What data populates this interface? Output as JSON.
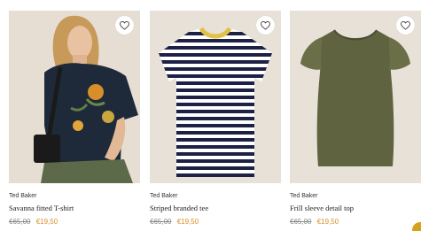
{
  "products": [
    {
      "brand": "Ted Baker",
      "title": "Savanna fitted T-shirt",
      "old_price": "€65,00",
      "new_price": "€19,50",
      "wishlist_icon": "heart-outline-icon"
    },
    {
      "brand": "Ted Baker",
      "title": "Striped branded tee",
      "old_price": "€65,00",
      "new_price": "€19,50",
      "wishlist_icon": "heart-outline-icon"
    },
    {
      "brand": "Ted Baker",
      "title": "Frill sleeve detail top",
      "old_price": "€65,00",
      "new_price": "€19,50",
      "wishlist_icon": "heart-outline-icon"
    }
  ],
  "colors": {
    "sale_price": "#d98f29",
    "old_price": "#8a8a8a",
    "image_background": "#e7e1d8"
  }
}
